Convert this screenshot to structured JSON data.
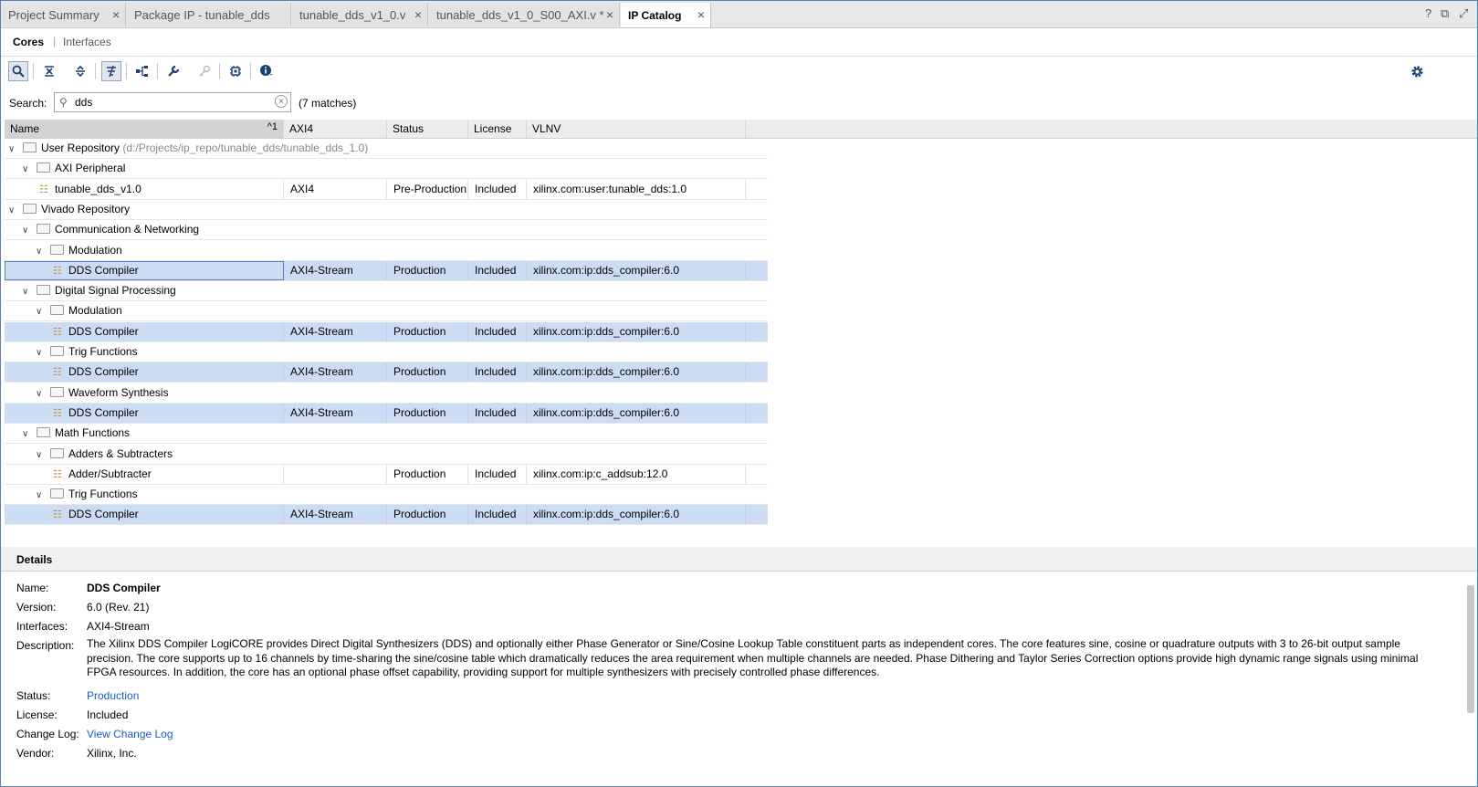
{
  "tabs": [
    {
      "label": "Project Summary",
      "close": "×"
    },
    {
      "label": "Package IP - tunable_dds",
      "close": ""
    },
    {
      "label": "tunable_dds_v1_0.v",
      "close": "×"
    },
    {
      "label": "tunable_dds_v1_0_S00_AXI.v *",
      "close": "×"
    },
    {
      "label": "IP Catalog",
      "close": "×"
    }
  ],
  "window_controls": {
    "help": "?",
    "restore": "⧉",
    "float": "⤢"
  },
  "subtabs": {
    "cores": "Cores",
    "separator": "|",
    "interfaces": "Interfaces"
  },
  "toolbar_icons": [
    "search-icon",
    "collapse-all-icon",
    "expand-all-icon",
    "filter-icon",
    "hierarchy-icon",
    "customize-icon",
    "license-icon",
    "chip-icon",
    "info-icon",
    "settings-icon"
  ],
  "search": {
    "label": "Search:",
    "value": "dds",
    "clear": "×",
    "matches": "(7 matches)"
  },
  "columns": {
    "name": "Name",
    "sort": "^1",
    "axi4": "AXI4",
    "status": "Status",
    "license": "License",
    "vlnv": "VLNV"
  },
  "rows": [
    {
      "level": 0,
      "kind": "folder",
      "name": "User Repository",
      "path": " (d:/Projects/ip_repo/tunable_dds/tunable_dds_1.0)",
      "axi4": "",
      "status": "",
      "license": "",
      "vlnv": "",
      "selected": false
    },
    {
      "level": 1,
      "kind": "folder",
      "name": "AXI Peripheral",
      "path": "",
      "axi4": "",
      "status": "",
      "license": "",
      "vlnv": "",
      "selected": false
    },
    {
      "level": 2,
      "kind": "ip",
      "name": "tunable_dds_v1.0",
      "path": "",
      "axi4": "AXI4",
      "status": "Pre-Production",
      "license": "Included",
      "vlnv": "xilinx.com:user:tunable_dds:1.0",
      "selected": false
    },
    {
      "level": 0,
      "kind": "folder",
      "name": "Vivado Repository",
      "path": "",
      "axi4": "",
      "status": "",
      "license": "",
      "vlnv": "",
      "selected": false
    },
    {
      "level": 1,
      "kind": "folder",
      "name": "Communication & Networking",
      "path": "",
      "axi4": "",
      "status": "",
      "license": "",
      "vlnv": "",
      "selected": false
    },
    {
      "level": 2,
      "kind": "folder",
      "name": "Modulation",
      "path": "",
      "axi4": "",
      "status": "",
      "license": "",
      "vlnv": "",
      "selected": false
    },
    {
      "level": 3,
      "kind": "ip",
      "name": "DDS Compiler",
      "path": "",
      "axi4": "AXI4-Stream",
      "status": "Production",
      "license": "Included",
      "vlnv": "xilinx.com:ip:dds_compiler:6.0",
      "selected": true,
      "focus": true
    },
    {
      "level": 1,
      "kind": "folder",
      "name": "Digital Signal Processing",
      "path": "",
      "axi4": "",
      "status": "",
      "license": "",
      "vlnv": "",
      "selected": false
    },
    {
      "level": 2,
      "kind": "folder",
      "name": "Modulation",
      "path": "",
      "axi4": "",
      "status": "",
      "license": "",
      "vlnv": "",
      "selected": false
    },
    {
      "level": 3,
      "kind": "ip",
      "name": "DDS Compiler",
      "path": "",
      "axi4": "AXI4-Stream",
      "status": "Production",
      "license": "Included",
      "vlnv": "xilinx.com:ip:dds_compiler:6.0",
      "selected": true
    },
    {
      "level": 2,
      "kind": "folder",
      "name": "Trig Functions",
      "path": "",
      "axi4": "",
      "status": "",
      "license": "",
      "vlnv": "",
      "selected": false
    },
    {
      "level": 3,
      "kind": "ip",
      "name": "DDS Compiler",
      "path": "",
      "axi4": "AXI4-Stream",
      "status": "Production",
      "license": "Included",
      "vlnv": "xilinx.com:ip:dds_compiler:6.0",
      "selected": true
    },
    {
      "level": 2,
      "kind": "folder",
      "name": "Waveform Synthesis",
      "path": "",
      "axi4": "",
      "status": "",
      "license": "",
      "vlnv": "",
      "selected": false
    },
    {
      "level": 3,
      "kind": "ip",
      "name": "DDS Compiler",
      "path": "",
      "axi4": "AXI4-Stream",
      "status": "Production",
      "license": "Included",
      "vlnv": "xilinx.com:ip:dds_compiler:6.0",
      "selected": true
    },
    {
      "level": 1,
      "kind": "folder",
      "name": "Math Functions",
      "path": "",
      "axi4": "",
      "status": "",
      "license": "",
      "vlnv": "",
      "selected": false
    },
    {
      "level": 2,
      "kind": "folder",
      "name": "Adders & Subtracters",
      "path": "",
      "axi4": "",
      "status": "",
      "license": "",
      "vlnv": "",
      "selected": false
    },
    {
      "level": 3,
      "kind": "ip",
      "name": "Adder/Subtracter",
      "path": "",
      "axi4": "",
      "status": "Production",
      "license": "Included",
      "vlnv": "xilinx.com:ip:c_addsub:12.0",
      "selected": false
    },
    {
      "level": 2,
      "kind": "folder",
      "name": "Trig Functions",
      "path": "",
      "axi4": "",
      "status": "",
      "license": "",
      "vlnv": "",
      "selected": false
    },
    {
      "level": 3,
      "kind": "ip",
      "name": "DDS Compiler",
      "path": "",
      "axi4": "AXI4-Stream",
      "status": "Production",
      "license": "Included",
      "vlnv": "xilinx.com:ip:dds_compiler:6.0",
      "selected": true
    }
  ],
  "details": {
    "title": "Details",
    "name_label": "Name:",
    "name": "DDS Compiler",
    "version_label": "Version:",
    "version": "6.0 (Rev. 21)",
    "interfaces_label": "Interfaces:",
    "interfaces": "AXI4-Stream",
    "description_label": "Description:",
    "description": "The Xilinx DDS Compiler LogiCORE provides Direct Digital Synthesizers (DDS) and optionally either Phase Generator or Sine/Cosine Lookup Table constituent parts as independent cores. The core features sine, cosine or quadrature outputs with 3 to 26-bit output sample precision. The core supports up to 16 channels by time-sharing the sine/cosine table which dramatically reduces the area requirement when multiple channels are needed.  Phase Dithering and Taylor Series Correction options provide high dynamic range signals using minimal FPGA resources. In addition, the core has an optional phase offset capability, providing support for multiple synthesizers with precisely controlled phase differences.",
    "status_label": "Status:",
    "status": "Production",
    "license_label": "License:",
    "license": "Included",
    "changelog_label": "Change Log:",
    "changelog": "View Change Log",
    "vendor_label": "Vendor:",
    "vendor": "Xilinx, Inc."
  },
  "colors": {
    "selection": "#cddcf5",
    "link": "#1a5fc4",
    "accent": "#1c3f74"
  }
}
